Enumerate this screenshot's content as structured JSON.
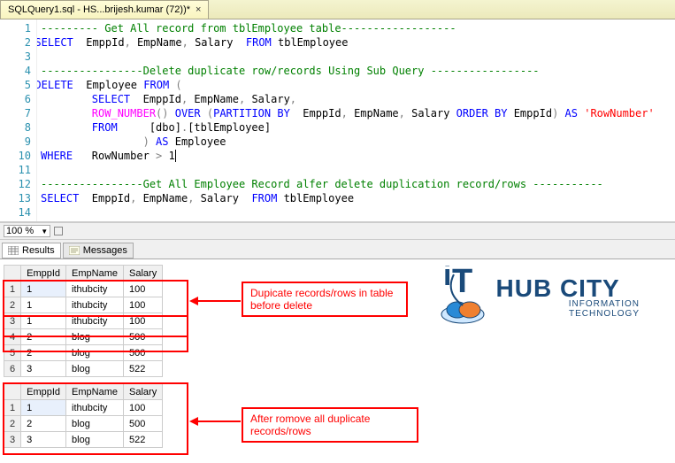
{
  "tab": {
    "title": "SQLQuery1.sql - HS...brijesh.kumar (72))*"
  },
  "zoom": "100 %",
  "editor": {
    "lines": [
      {
        "n": 1,
        "seg": [
          {
            "t": "--------- Get All record from tblEmployee table------------------",
            "c": "cmt"
          }
        ]
      },
      {
        "n": 2,
        "fold": true,
        "seg": [
          {
            "t": "SELECT",
            "c": "kw"
          },
          {
            "t": "  EmppId"
          },
          {
            "t": ",",
            "c": "gray"
          },
          {
            "t": " EmpName"
          },
          {
            "t": ",",
            "c": "gray"
          },
          {
            "t": " Salary  "
          },
          {
            "t": "FROM",
            "c": "kw"
          },
          {
            "t": " tblEmployee"
          }
        ]
      },
      {
        "n": 3,
        "seg": []
      },
      {
        "n": 4,
        "seg": [
          {
            "t": "----------------Delete duplicate row/records Using Sub Query -----------------",
            "c": "cmt"
          }
        ]
      },
      {
        "n": 5,
        "fold": true,
        "seg": [
          {
            "t": "DELETE",
            "c": "kw"
          },
          {
            "t": "  Employee "
          },
          {
            "t": "FROM ",
            "c": "kw"
          },
          {
            "t": "(",
            "c": "gray"
          }
        ]
      },
      {
        "n": 6,
        "seg": [
          {
            "t": "        "
          },
          {
            "t": "SELECT",
            "c": "kw"
          },
          {
            "t": "  EmppId"
          },
          {
            "t": ",",
            "c": "gray"
          },
          {
            "t": " EmpName"
          },
          {
            "t": ",",
            "c": "gray"
          },
          {
            "t": " Salary"
          },
          {
            "t": ",",
            "c": "gray"
          }
        ]
      },
      {
        "n": 7,
        "seg": [
          {
            "t": "        "
          },
          {
            "t": "ROW_NUMBER",
            "c": "fn"
          },
          {
            "t": "() ",
            "c": "gray"
          },
          {
            "t": "OVER ",
            "c": "kw"
          },
          {
            "t": "(",
            "c": "gray"
          },
          {
            "t": "PARTITION",
            "c": "kw"
          },
          {
            "t": " "
          },
          {
            "t": "BY",
            "c": "kw"
          },
          {
            "t": "  EmppId"
          },
          {
            "t": ",",
            "c": "gray"
          },
          {
            "t": " EmpName"
          },
          {
            "t": ",",
            "c": "gray"
          },
          {
            "t": " Salary "
          },
          {
            "t": "ORDER",
            "c": "kw"
          },
          {
            "t": " "
          },
          {
            "t": "BY",
            "c": "kw"
          },
          {
            "t": " EmppId"
          },
          {
            "t": ")",
            "c": "gray"
          },
          {
            "t": " "
          },
          {
            "t": "AS",
            "c": "kw"
          },
          {
            "t": " "
          },
          {
            "t": "'RowNumber'",
            "c": "str"
          }
        ]
      },
      {
        "n": 8,
        "seg": [
          {
            "t": "        "
          },
          {
            "t": "FROM",
            "c": "kw"
          },
          {
            "t": "     [dbo]"
          },
          {
            "t": ".",
            "c": "gray"
          },
          {
            "t": "[tblEmployee]"
          }
        ]
      },
      {
        "n": 9,
        "seg": [
          {
            "t": "                "
          },
          {
            "t": ") ",
            "c": "gray"
          },
          {
            "t": "AS",
            "c": "kw"
          },
          {
            "t": " Employee"
          }
        ]
      },
      {
        "n": 10,
        "seg": [
          {
            "t": "WHERE",
            "c": "kw"
          },
          {
            "t": "   RowNumber "
          },
          {
            "t": ">",
            "c": "gray"
          },
          {
            "t": " 1",
            "cursor": true
          }
        ]
      },
      {
        "n": 11,
        "seg": []
      },
      {
        "n": 12,
        "seg": [
          {
            "t": "----------------Get All Employee Record alfer delete duplication record/rows -----------",
            "c": "cmt"
          }
        ]
      },
      {
        "n": 13,
        "seg": [
          {
            "t": "SELECT",
            "c": "kw"
          },
          {
            "t": "  EmppId"
          },
          {
            "t": ",",
            "c": "gray"
          },
          {
            "t": " EmpName"
          },
          {
            "t": ",",
            "c": "gray"
          },
          {
            "t": " Salary  "
          },
          {
            "t": "FROM",
            "c": "kw"
          },
          {
            "t": " tblEmployee"
          }
        ]
      },
      {
        "n": 14,
        "seg": []
      }
    ]
  },
  "resultTabs": {
    "results": "Results",
    "messages": "Messages"
  },
  "table1": {
    "headers": [
      "",
      "EmppId",
      "EmpName",
      "Salary"
    ],
    "rows": [
      [
        "1",
        "1",
        "ithubcity",
        "100"
      ],
      [
        "2",
        "1",
        "ithubcity",
        "100"
      ],
      [
        "3",
        "1",
        "ithubcity",
        "100"
      ],
      [
        "4",
        "2",
        "blog",
        "500"
      ],
      [
        "5",
        "2",
        "blog",
        "500"
      ],
      [
        "6",
        "3",
        "blog",
        "522"
      ]
    ]
  },
  "table2": {
    "headers": [
      "",
      "EmppId",
      "EmpName",
      "Salary"
    ],
    "rows": [
      [
        "1",
        "1",
        "ithubcity",
        "100"
      ],
      [
        "2",
        "2",
        "blog",
        "500"
      ],
      [
        "3",
        "3",
        "blog",
        "522"
      ]
    ]
  },
  "annotations": {
    "a1": "Dupicate records/rows in table before delete",
    "a2": "After romove all duplicate records/rows"
  },
  "logo": {
    "main": "HUB CITY",
    "sub": "INFORMATION TECHNOLOGY"
  }
}
